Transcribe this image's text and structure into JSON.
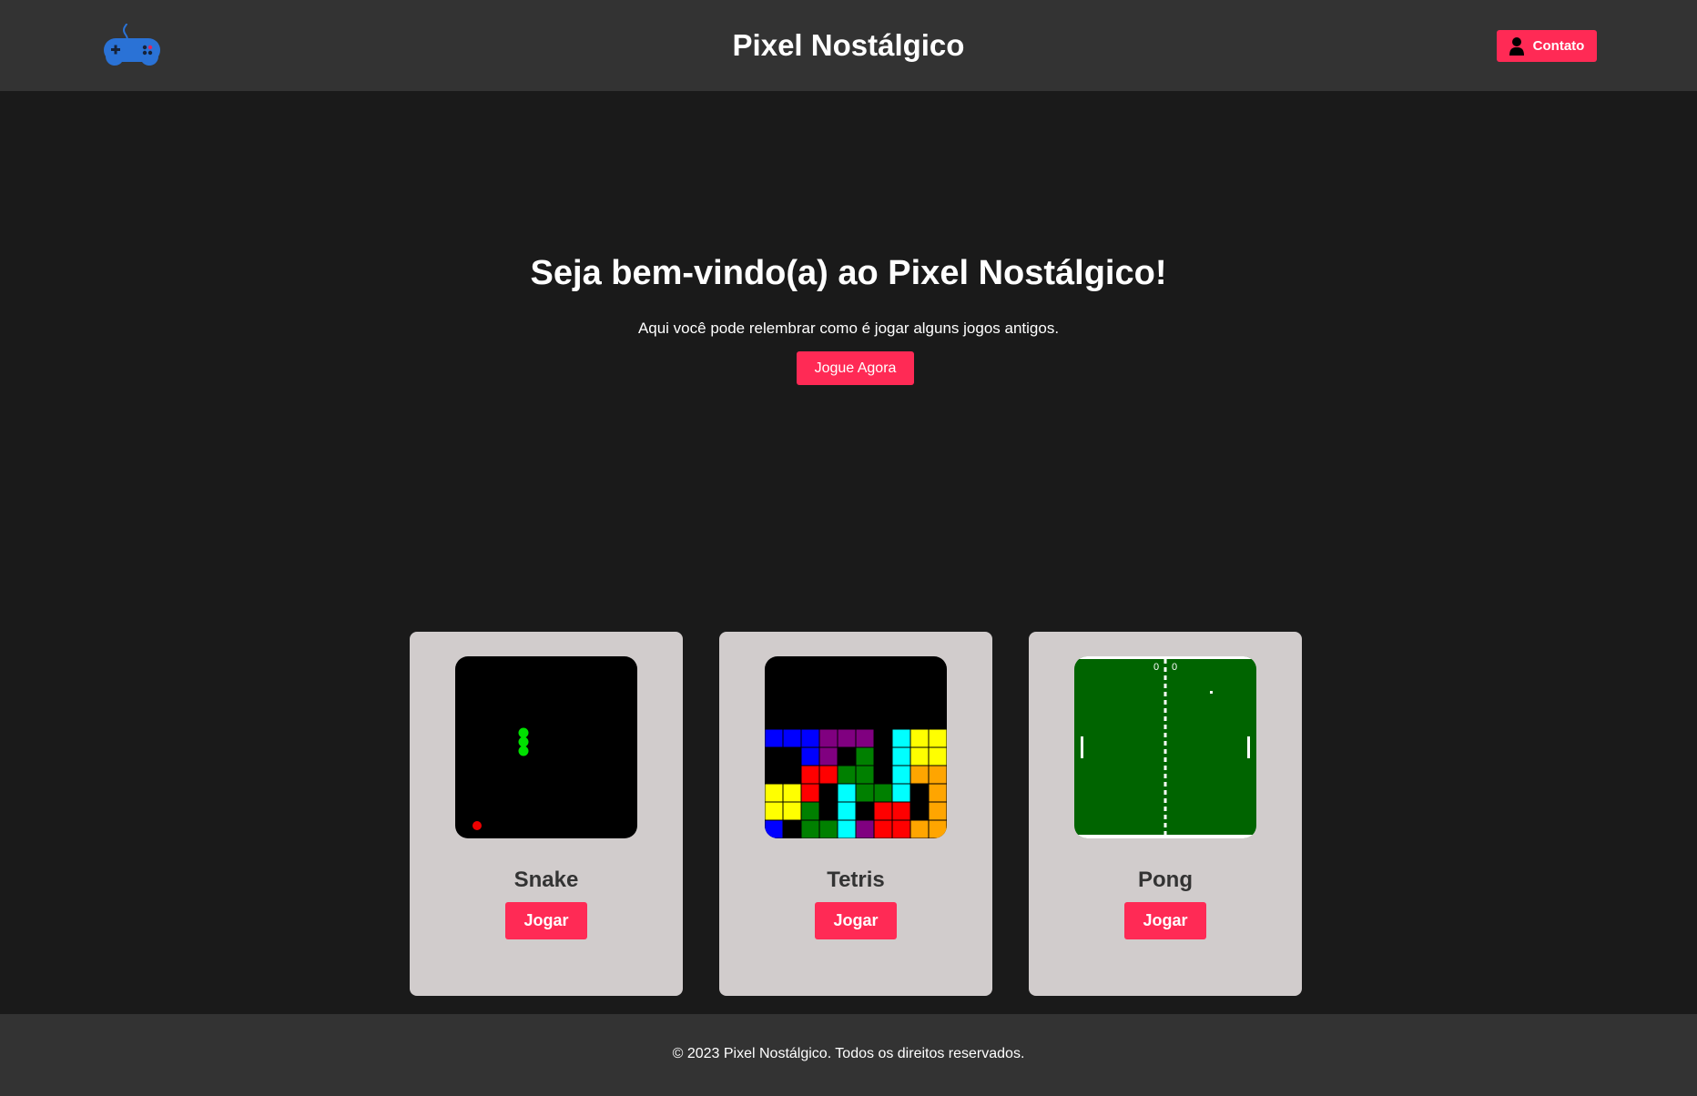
{
  "header": {
    "title": "Pixel Nostálgico",
    "contact_label": "Contato",
    "logo_icon": "gamepad-icon",
    "contact_icon": "user-icon"
  },
  "hero": {
    "title": "Seja bem-vindo(a) ao Pixel Nostálgico!",
    "subtitle": "Aqui você pode relembrar como é jogar alguns jogos antigos.",
    "button_label": "Jogue Agora"
  },
  "games": [
    {
      "title": "Snake",
      "button_label": "Jogar"
    },
    {
      "title": "Tetris",
      "button_label": "Jogar"
    },
    {
      "title": "Pong",
      "button_label": "Jogar",
      "score_left": "0",
      "score_right": "0"
    }
  ],
  "footer": {
    "text": "© 2023 Pixel Nostálgico. Todos os direitos reservados."
  },
  "colors": {
    "accent": "#ff2a55",
    "header_bg": "#333333",
    "page_bg": "#1a1a1a",
    "card_bg": "#d1cccc",
    "logo": "#2a72d6"
  }
}
